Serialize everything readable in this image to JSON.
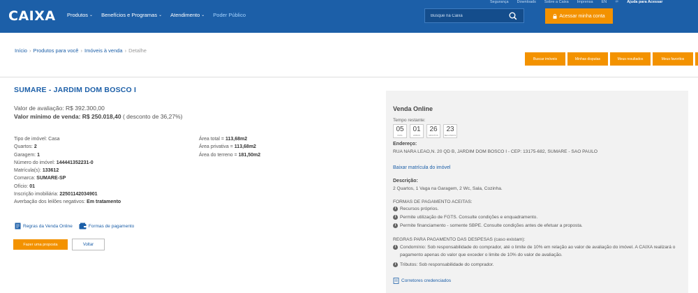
{
  "header": {
    "logo": "CAIXA",
    "nav": [
      {
        "label": "Produtos",
        "chev": "⌄"
      },
      {
        "label": "Benefícios e Programas",
        "chev": "⌄"
      },
      {
        "label": "Atendimento",
        "chev": "⌄"
      },
      {
        "label": "Poder Público",
        "chev": ""
      }
    ],
    "util": [
      "Segurança",
      "Downloads",
      "Sobre a Caixa",
      "Imprensa",
      "EN",
      "Ajuda para Acessar"
    ],
    "search_placeholder": "Busque na Caixa",
    "access_label": "Acessar minha conta"
  },
  "breadcrumb": [
    "Início",
    "Produtos para você",
    "Imóveis à venda",
    "Detalhe"
  ],
  "quick_buttons": [
    "Buscar imóveis",
    "Minhas disputas",
    "Meus resultados",
    "Meus favoritos",
    ""
  ],
  "property": {
    "title": "SUMARE - JARDIM DOM BOSCO I",
    "avaliacao": "Valor de avaliação: R$ 392.300,00",
    "minimo_label": "Valor mínimo de venda:",
    "minimo_value": "R$ 250.018,40",
    "desconto": "( desconto de 36,27%)",
    "left_details": [
      {
        "label": "Tipo de imóvel:",
        "value": "Casa"
      },
      {
        "label": "Quartos:",
        "value": "2"
      },
      {
        "label": "Garagem:",
        "value": "1"
      },
      {
        "label": "Número do imóvel:",
        "value": "144441352231-0"
      },
      {
        "label": "Matrícula(s):",
        "value": "133612"
      },
      {
        "label": "Comarca:",
        "value": "SUMARE-SP"
      },
      {
        "label": "Ofício:",
        "value": "01"
      },
      {
        "label": "Inscrição imobiliária:",
        "value": "22501142034901"
      },
      {
        "label": "Averbação dos leilões negativos:",
        "value": "Em tratamento"
      }
    ],
    "right_details": [
      {
        "label": "Área total =",
        "value": "113,68m2"
      },
      {
        "label": "Área privativa =",
        "value": "113,68m2"
      },
      {
        "label": "Área do terreno =",
        "value": "181,50m2"
      }
    ],
    "link_regras": "Regras da Venda Online",
    "link_pagamento": "Formas de pagamento",
    "btn_proposta": "Fazer uma proposta",
    "btn_voltar": "Voltar"
  },
  "panel": {
    "title": "Venda Online",
    "tempo_label": "Tempo restante:",
    "countdown": [
      {
        "num": "05",
        "unit": "DIAS"
      },
      {
        "num": "01",
        "unit": "HORAS"
      },
      {
        "num": "26",
        "unit": "MINUTOS"
      },
      {
        "num": "23",
        "unit": "SEGUNDOS"
      }
    ],
    "endereco_label": "Endereço:",
    "endereco": "RUA NARA LEAO,N. 20 QD B, JARDIM DOM BOSCO I - CEP: 13175-682, SUMARE - SAO PAULO",
    "matricula_link": "Baixar matrícula do imóvel",
    "descricao_label": "Descrição:",
    "descricao": "2 Quartos, 1 Vaga na Garagem, 2 Wc, Sala, Cozinha.",
    "formas_title": "FORMAS DE PAGAMENTO ACEITAS:",
    "formas": [
      "Recursos próprios.",
      "Permite utilização de FGTS. Consulte condições e enquadramento.",
      "Permite financiamento - somente SBPE. Consulte condições antes de efetuar a proposta."
    ],
    "regras_title": "REGRAS PARA PAGAMENTO DAS DESPESAS (caso existam):",
    "regras": [
      "Condomínio: Sob responsabilidade do comprador, até o limite de 10% em relação ao valor de avaliação do imóvel. A CAIXA realizará o pagamento apenas do valor que exceder o limite de 10% do valor de avaliação.",
      "Tributos: Sob responsabilidade do comprador."
    ],
    "corretores": "Corretores credenciados"
  }
}
